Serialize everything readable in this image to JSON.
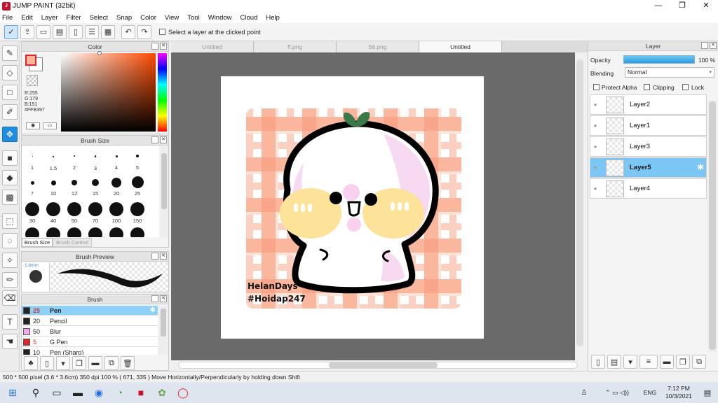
{
  "window": {
    "title": "JUMP PAINT (32bit)"
  },
  "menu": [
    "File",
    "Edit",
    "Layer",
    "Filter",
    "Select",
    "Snap",
    "Color",
    "View",
    "Tool",
    "Window",
    "Cloud",
    "Help"
  ],
  "toolbar": {
    "select_layer_label": "Select a layer at the clicked point"
  },
  "color_panel": {
    "title": "Color",
    "r": "R:255",
    "g": "G:179",
    "b": "B:151",
    "hex": "#FFB397",
    "fg_color": "#FFB397",
    "bg_color": "#ffffff"
  },
  "brush_size_panel": {
    "title": "Brush Size",
    "sizes": [
      "1",
      "1.5",
      "2",
      "3",
      "4",
      "5",
      "7",
      "10",
      "12",
      "15",
      "20",
      "25",
      "30",
      "40",
      "50",
      "70",
      "100",
      "150"
    ],
    "tab_active": "Brush Size",
    "tab_inactive": "Brush Control"
  },
  "brush_preview": {
    "title": "Brush Preview",
    "size_label": "1.8mm"
  },
  "brush_panel": {
    "title": "Brush",
    "items": [
      {
        "size": "25",
        "name": "Pen",
        "color": "#222222",
        "selected": true
      },
      {
        "size": "20",
        "name": "Pencil",
        "color": "#222222"
      },
      {
        "size": "50",
        "name": "Blur",
        "color": "#f7a8e8"
      },
      {
        "size": "5",
        "name": "G Pen",
        "color": "#e0242a"
      },
      {
        "size": "10",
        "name": "Pen (Sharp)",
        "color": "#222222"
      }
    ]
  },
  "tabs": [
    {
      "label": "Untitled"
    },
    {
      "label": "ff.png"
    },
    {
      "label": "56.png"
    },
    {
      "label": "Untitled",
      "active": true
    }
  ],
  "layer_panel": {
    "title": "Layer",
    "opacity_label": "Opacity",
    "opacity_value": "100 %",
    "blending_label": "Blending",
    "blending_value": "Normal",
    "protect_alpha": "Protect Alpha",
    "clipping": "Clipping",
    "lock": "Lock",
    "layers": [
      {
        "name": "Layer2"
      },
      {
        "name": "Layer1"
      },
      {
        "name": "Layer3"
      },
      {
        "name": "Layer5",
        "selected": true
      },
      {
        "name": "Layer4"
      }
    ]
  },
  "artwork": {
    "signature_line1": "HelanDays",
    "signature_line2": "#Hoidap247"
  },
  "status": {
    "text": "500 * 500 pixel  (3.6 * 3.6cm)  350 dpi  100 %  ( 671, 335 )  Move Horizontally/Perpendicularly by holding down Shift"
  },
  "taskbar": {
    "time": "7:12 PM",
    "date": "10/3/2021",
    "lang": "ENG"
  }
}
